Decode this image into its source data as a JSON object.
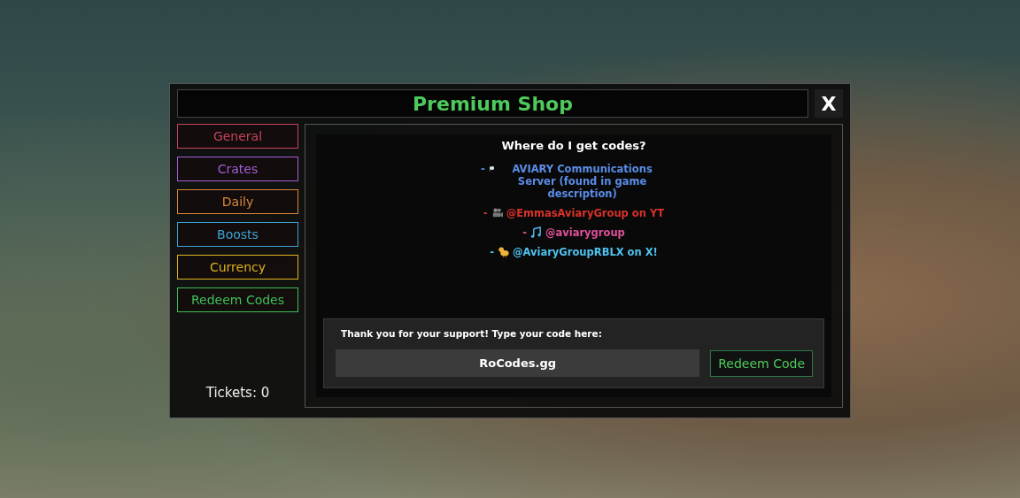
{
  "window": {
    "title": "Premium Shop",
    "close": "X"
  },
  "tabs": [
    {
      "label": "General",
      "color": "#c8435c"
    },
    {
      "label": "Crates",
      "color": "#a45fd8"
    },
    {
      "label": "Daily",
      "color": "#d8873a"
    },
    {
      "label": "Boosts",
      "color": "#3ea3d4"
    },
    {
      "label": "Currency",
      "color": "#e0b21c"
    },
    {
      "label": "Redeem Codes",
      "color": "#3fbf5a"
    }
  ],
  "tickets": "Tickets: 0",
  "heading": "Where do I get codes?",
  "sources": [
    {
      "prefix": "-",
      "kind": "bubble",
      "text": "AVIARY Communications Server (found in game description)",
      "color": "#5b8de8"
    },
    {
      "prefix": "-",
      "kind": "camera",
      "text": "@EmmasAviaryGroup on YT",
      "color": "#d8322a"
    },
    {
      "prefix": "-",
      "kind": "note",
      "text": "@aviarygroup",
      "color": "#e0509a"
    },
    {
      "prefix": "-",
      "kind": "bird",
      "text": "@AviaryGroupRBLX on X!",
      "color": "#4fc3f0"
    }
  ],
  "redeem": {
    "prompt": "Thank you for your support! Type your code here:",
    "value": "RoCodes.gg",
    "button": "Redeem Code"
  }
}
